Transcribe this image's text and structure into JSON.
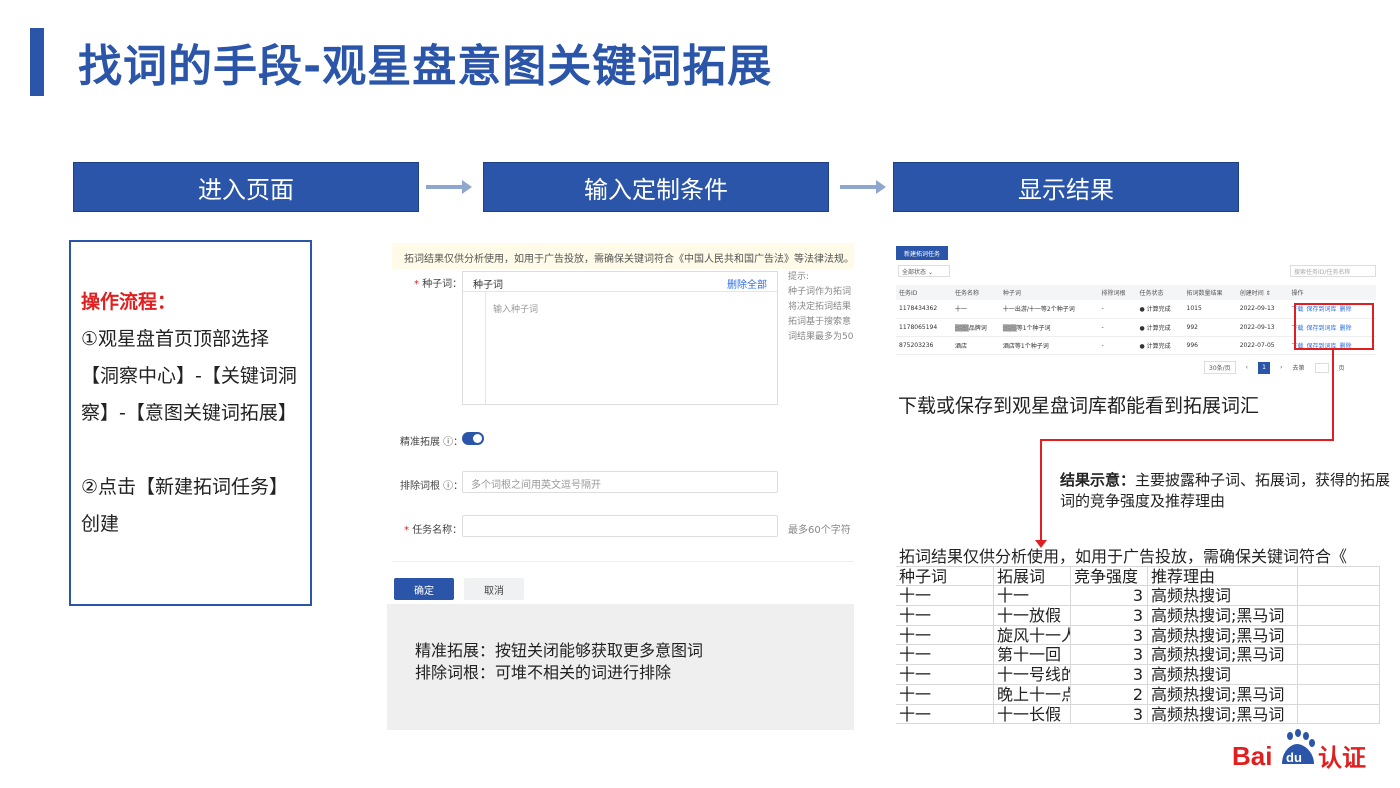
{
  "title": "找词的手段-观星盘意图关键词拓展",
  "steps": [
    "进入页面",
    "输入定制条件",
    "显示结果"
  ],
  "flow": {
    "heading": "操作流程：",
    "step1": "①观星盘首页顶部选择【洞察中心】-【关键词洞察】-【意图关键词拓展】",
    "step2": "②点击【新建拓词任务】创建"
  },
  "form": {
    "notice": "拓词结果仅供分析使用，如用于广告投放，需确保关键词符合《中国人民共和国广告法》等法律法规。",
    "seed_label": "种子词：",
    "seed_head": "种子词",
    "delete_all": "删除全部",
    "seed_placeholder": "输入种子词",
    "hint_lines": [
      "提示:",
      "种子词作为拓词",
      "将决定拓词结果",
      "拓词基于搜索意",
      "词结果最多为50"
    ],
    "precise_label": "精准拓展 ⓘ：",
    "exclude_label": "排除词根 ⓘ：",
    "exclude_placeholder": "多个词根之间用英文逗号隔开",
    "task_label": "任务名称：",
    "task_hint": "最多60个字符",
    "confirm": "确定",
    "cancel": "取消"
  },
  "note": {
    "line1": "精准拓展：按钮关闭能够获取更多意图词",
    "line2": "排除词根：可堆不相关的词进行排除"
  },
  "result": {
    "new_task": "新建拓词任务",
    "status_filter": "全部状态",
    "search_placeholder": "搜索任务ID/任务名称",
    "columns": [
      "任务ID",
      "任务名称",
      "种子词",
      "排除词根",
      "任务状态",
      "拓词数量结果",
      "创建时间 ⇕",
      "操作"
    ],
    "rows": [
      [
        "1178434362",
        "十一",
        "十一出游/十一等2个种子词",
        "-",
        "● 计算完成",
        "1015",
        "2022-09-13"
      ],
      [
        "1178065194",
        "▒▒▒品牌词",
        "▒▒▒等1个种子词",
        "-",
        "● 计算完成",
        "992",
        "2022-09-13"
      ],
      [
        "875203236",
        "酒店",
        "酒店等1个种子词",
        "-",
        "● 计算完成",
        "996",
        "2022-07-05"
      ]
    ],
    "actions": [
      "下载",
      "保存到词库",
      "删除"
    ],
    "pager_size": "30条/页",
    "pager_page": "1",
    "pager_goto": "去第",
    "pager_unit": "页"
  },
  "caption1": "下载或保存到观星盘词库都能看到拓展词汇",
  "caption2_bold": "结果示意：",
  "caption2_rest": "主要披露种子词、拓展词，获得的拓展词的竞争强度及推荐理由",
  "excel": {
    "notice": "拓词结果仅供分析使用，如用于广告投放，需确保关键词符合《",
    "headers": [
      "种子词",
      "拓展词",
      "竞争强度",
      "推荐理由"
    ],
    "rows": [
      [
        "十一",
        "十一",
        "3",
        "高频热搜词"
      ],
      [
        "十一",
        "十一放假",
        "3",
        "高频热搜词;黑马词"
      ],
      [
        "十一",
        "旋风十一人",
        "3",
        "高频热搜词;黑马词"
      ],
      [
        "十一",
        "第十一回",
        "3",
        "高频热搜词;黑马词"
      ],
      [
        "十一",
        "十一号线的",
        "3",
        "高频热搜词"
      ],
      [
        "十一",
        "晚上十一点",
        "2",
        "高频热搜词;黑马词"
      ],
      [
        "十一",
        "十一长假",
        "3",
        "高频热搜词;黑马词"
      ]
    ]
  },
  "logo": {
    "bai": "Bai",
    "du": "du",
    "cert": "认证"
  },
  "colors": {
    "brand": "#2b55a8",
    "accent_red": "#e02020"
  }
}
